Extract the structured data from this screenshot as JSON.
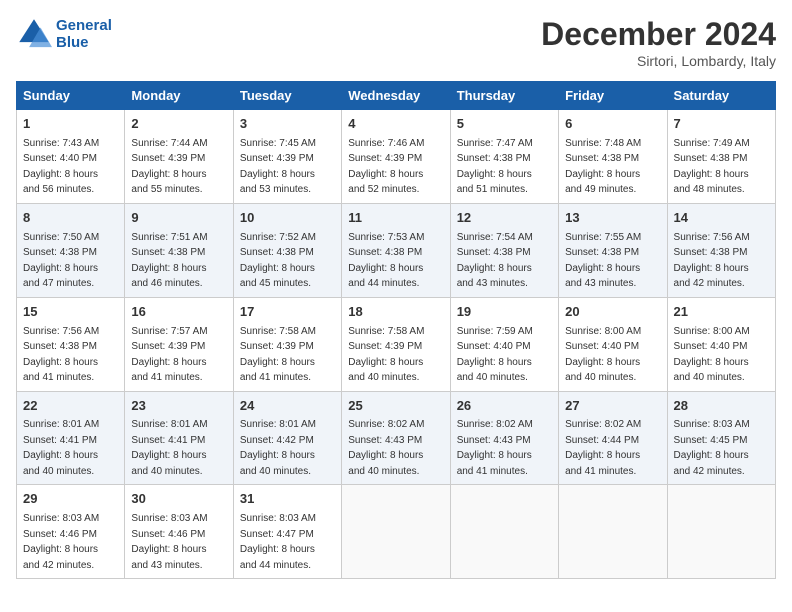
{
  "header": {
    "logo_line1": "General",
    "logo_line2": "Blue",
    "month_title": "December 2024",
    "location": "Sirtori, Lombardy, Italy"
  },
  "weekdays": [
    "Sunday",
    "Monday",
    "Tuesday",
    "Wednesday",
    "Thursday",
    "Friday",
    "Saturday"
  ],
  "weeks": [
    [
      {
        "day": "1",
        "sunrise": "7:43 AM",
        "sunset": "4:40 PM",
        "daylight": "8 hours and 56 minutes."
      },
      {
        "day": "2",
        "sunrise": "7:44 AM",
        "sunset": "4:39 PM",
        "daylight": "8 hours and 55 minutes."
      },
      {
        "day": "3",
        "sunrise": "7:45 AM",
        "sunset": "4:39 PM",
        "daylight": "8 hours and 53 minutes."
      },
      {
        "day": "4",
        "sunrise": "7:46 AM",
        "sunset": "4:39 PM",
        "daylight": "8 hours and 52 minutes."
      },
      {
        "day": "5",
        "sunrise": "7:47 AM",
        "sunset": "4:38 PM",
        "daylight": "8 hours and 51 minutes."
      },
      {
        "day": "6",
        "sunrise": "7:48 AM",
        "sunset": "4:38 PM",
        "daylight": "8 hours and 49 minutes."
      },
      {
        "day": "7",
        "sunrise": "7:49 AM",
        "sunset": "4:38 PM",
        "daylight": "8 hours and 48 minutes."
      }
    ],
    [
      {
        "day": "8",
        "sunrise": "7:50 AM",
        "sunset": "4:38 PM",
        "daylight": "8 hours and 47 minutes."
      },
      {
        "day": "9",
        "sunrise": "7:51 AM",
        "sunset": "4:38 PM",
        "daylight": "8 hours and 46 minutes."
      },
      {
        "day": "10",
        "sunrise": "7:52 AM",
        "sunset": "4:38 PM",
        "daylight": "8 hours and 45 minutes."
      },
      {
        "day": "11",
        "sunrise": "7:53 AM",
        "sunset": "4:38 PM",
        "daylight": "8 hours and 44 minutes."
      },
      {
        "day": "12",
        "sunrise": "7:54 AM",
        "sunset": "4:38 PM",
        "daylight": "8 hours and 43 minutes."
      },
      {
        "day": "13",
        "sunrise": "7:55 AM",
        "sunset": "4:38 PM",
        "daylight": "8 hours and 43 minutes."
      },
      {
        "day": "14",
        "sunrise": "7:56 AM",
        "sunset": "4:38 PM",
        "daylight": "8 hours and 42 minutes."
      }
    ],
    [
      {
        "day": "15",
        "sunrise": "7:56 AM",
        "sunset": "4:38 PM",
        "daylight": "8 hours and 41 minutes."
      },
      {
        "day": "16",
        "sunrise": "7:57 AM",
        "sunset": "4:39 PM",
        "daylight": "8 hours and 41 minutes."
      },
      {
        "day": "17",
        "sunrise": "7:58 AM",
        "sunset": "4:39 PM",
        "daylight": "8 hours and 41 minutes."
      },
      {
        "day": "18",
        "sunrise": "7:58 AM",
        "sunset": "4:39 PM",
        "daylight": "8 hours and 40 minutes."
      },
      {
        "day": "19",
        "sunrise": "7:59 AM",
        "sunset": "4:40 PM",
        "daylight": "8 hours and 40 minutes."
      },
      {
        "day": "20",
        "sunrise": "8:00 AM",
        "sunset": "4:40 PM",
        "daylight": "8 hours and 40 minutes."
      },
      {
        "day": "21",
        "sunrise": "8:00 AM",
        "sunset": "4:40 PM",
        "daylight": "8 hours and 40 minutes."
      }
    ],
    [
      {
        "day": "22",
        "sunrise": "8:01 AM",
        "sunset": "4:41 PM",
        "daylight": "8 hours and 40 minutes."
      },
      {
        "day": "23",
        "sunrise": "8:01 AM",
        "sunset": "4:41 PM",
        "daylight": "8 hours and 40 minutes."
      },
      {
        "day": "24",
        "sunrise": "8:01 AM",
        "sunset": "4:42 PM",
        "daylight": "8 hours and 40 minutes."
      },
      {
        "day": "25",
        "sunrise": "8:02 AM",
        "sunset": "4:43 PM",
        "daylight": "8 hours and 40 minutes."
      },
      {
        "day": "26",
        "sunrise": "8:02 AM",
        "sunset": "4:43 PM",
        "daylight": "8 hours and 41 minutes."
      },
      {
        "day": "27",
        "sunrise": "8:02 AM",
        "sunset": "4:44 PM",
        "daylight": "8 hours and 41 minutes."
      },
      {
        "day": "28",
        "sunrise": "8:03 AM",
        "sunset": "4:45 PM",
        "daylight": "8 hours and 42 minutes."
      }
    ],
    [
      {
        "day": "29",
        "sunrise": "8:03 AM",
        "sunset": "4:46 PM",
        "daylight": "8 hours and 42 minutes."
      },
      {
        "day": "30",
        "sunrise": "8:03 AM",
        "sunset": "4:46 PM",
        "daylight": "8 hours and 43 minutes."
      },
      {
        "day": "31",
        "sunrise": "8:03 AM",
        "sunset": "4:47 PM",
        "daylight": "8 hours and 44 minutes."
      },
      null,
      null,
      null,
      null
    ]
  ],
  "labels": {
    "sunrise": "Sunrise:",
    "sunset": "Sunset:",
    "daylight": "Daylight:"
  },
  "colors": {
    "header_bg": "#1a5fa8",
    "row_even": "#f0f4f9",
    "row_odd": "#ffffff"
  }
}
